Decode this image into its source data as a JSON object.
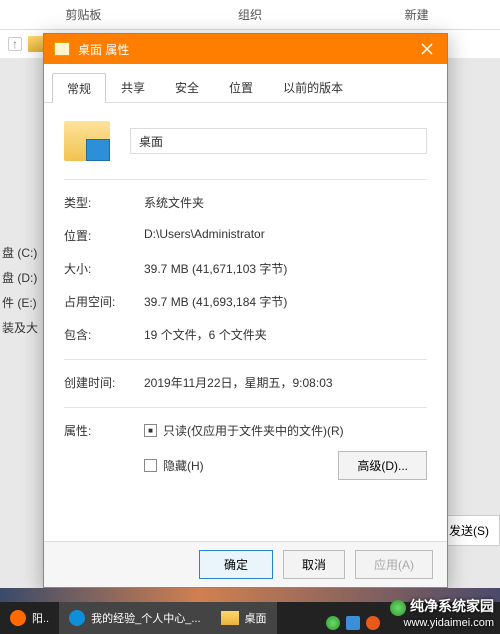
{
  "bg": {
    "header": [
      "剪贴板",
      "组织",
      "新建"
    ],
    "nav_arrow": "↑",
    "left_items": [
      "盘 (C:)",
      "盘 (D:)",
      "件 (E:)",
      "装及大"
    ],
    "send_btn": "发送(S)"
  },
  "dialog": {
    "title": "桌面 属性",
    "tabs": [
      "常规",
      "共享",
      "安全",
      "位置",
      "以前的版本"
    ],
    "active_tab": 0,
    "name": "桌面",
    "rows": {
      "type_label": "类型:",
      "type_val": "系统文件夹",
      "loc_label": "位置:",
      "loc_val": "D:\\Users\\Administrator",
      "size_label": "大小:",
      "size_val": "39.7 MB (41,671,103 字节)",
      "disk_label": "占用空间:",
      "disk_val": "39.7 MB (41,693,184 字节)",
      "contains_label": "包含:",
      "contains_val": "19 个文件，6 个文件夹",
      "created_label": "创建时间:",
      "created_val": "2019年11月22日，星期五，9:08:03",
      "attr_label": "属性:",
      "readonly_label": "只读(仅应用于文件夹中的文件)(R)",
      "readonly_checked": true,
      "hidden_label": "隐藏(H)",
      "hidden_checked": false,
      "advanced_btn": "高级(D)..."
    },
    "footer": {
      "ok": "确定",
      "cancel": "取消",
      "apply": "应用(A)"
    }
  },
  "taskbar": {
    "items": [
      {
        "label": "阳..",
        "color": "#ff6a00"
      },
      {
        "label": "我的经验_个人中心_...",
        "color": "#0e8fd8"
      },
      {
        "label": "桌面",
        "color": ""
      }
    ]
  },
  "watermark": {
    "brand": "纯净系统家园",
    "url": "www.yidaimei.com"
  }
}
